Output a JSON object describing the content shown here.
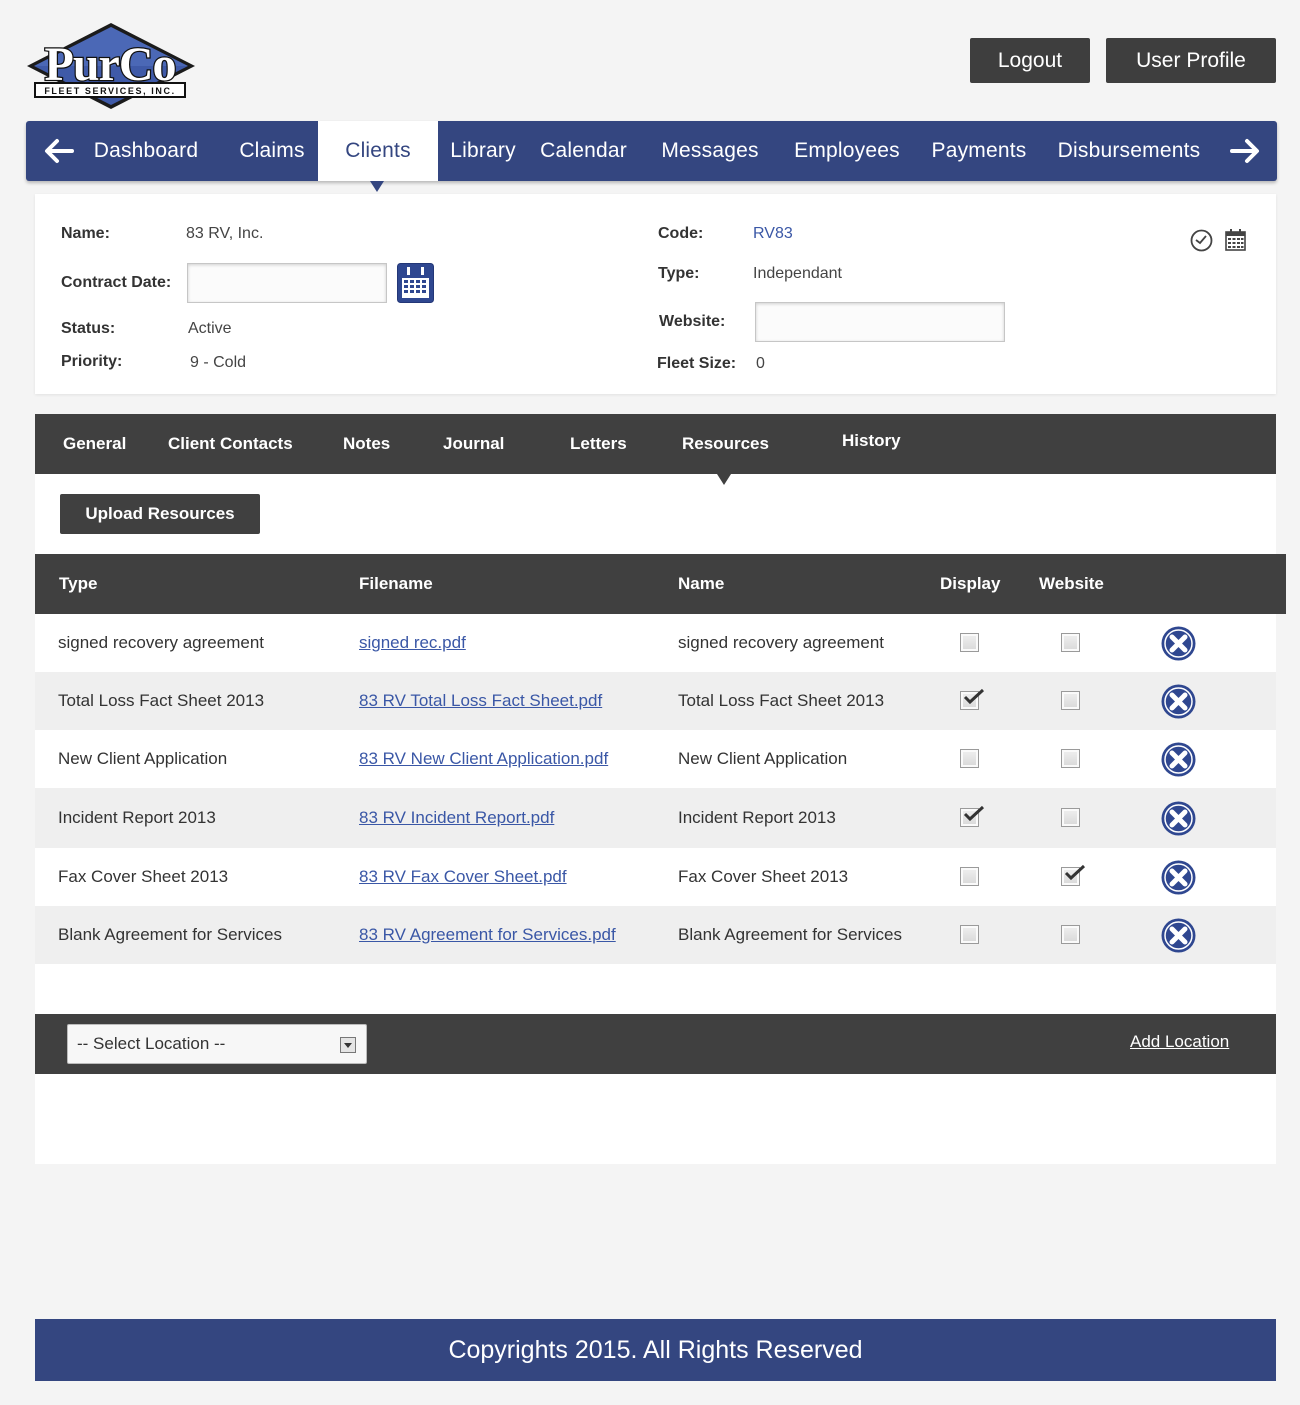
{
  "logo": {
    "name": "PurCo",
    "tagline": "FLEET SERVICES, INC."
  },
  "header": {
    "logout_label": "Logout",
    "profile_label": "User Profile"
  },
  "nav": {
    "items": [
      {
        "label": "Dashboard"
      },
      {
        "label": "Claims"
      },
      {
        "label": "Clients"
      },
      {
        "label": "Library"
      },
      {
        "label": "Calendar"
      },
      {
        "label": "Messages"
      },
      {
        "label": "Employees"
      },
      {
        "label": "Payments"
      },
      {
        "label": "Disbursements"
      }
    ],
    "active": "Clients"
  },
  "client": {
    "name_label": "Name:",
    "name_value": "83 RV, Inc.",
    "contract_label": "Contract Date:",
    "contract_value": "",
    "status_label": "Status:",
    "status_value": "Active",
    "priority_label": "Priority:",
    "priority_value": "9 - Cold",
    "code_label": "Code:",
    "code_value": "RV83",
    "type_label": "Type:",
    "type_value": "Independant",
    "website_label": "Website:",
    "website_value": "",
    "fleet_label": "Fleet Size:",
    "fleet_value": "0"
  },
  "subnav": {
    "items": [
      {
        "label": "General"
      },
      {
        "label": "Client Contacts"
      },
      {
        "label": "Notes"
      },
      {
        "label": "Journal"
      },
      {
        "label": "Letters"
      },
      {
        "label": "Resources"
      },
      {
        "label": "History"
      }
    ],
    "active": "Resources"
  },
  "upload_label": "Upload Resources",
  "table": {
    "headers": [
      "Type",
      "Filename",
      "Name",
      "Display",
      "Website"
    ],
    "rows": [
      {
        "type": "signed recovery agreement",
        "filename": "signed rec.pdf",
        "name": "signed recovery agreement",
        "display": false,
        "website": false
      },
      {
        "type": "Total Loss Fact Sheet 2013",
        "filename": "83 RV Total Loss Fact Sheet.pdf",
        "name": "Total Loss Fact Sheet 2013",
        "display": true,
        "website": false
      },
      {
        "type": "New Client Application",
        "filename": "83 RV New Client Application.pdf",
        "name": "New Client Application",
        "display": false,
        "website": false
      },
      {
        "type": "Incident Report 2013",
        "filename": "83 RV Incident Report.pdf",
        "name": "Incident Report 2013",
        "display": true,
        "website": false
      },
      {
        "type": "Fax Cover Sheet 2013",
        "filename": "83 RV Fax Cover Sheet.pdf",
        "name": "Fax Cover Sheet 2013",
        "display": false,
        "website": true
      },
      {
        "type": "Blank Agreement for Services",
        "filename": "83 RV Agreement for Services.pdf",
        "name": "Blank Agreement for Services",
        "display": false,
        "website": false
      }
    ]
  },
  "location": {
    "select_value": "-- Select Location --",
    "add_label": "Add Location"
  },
  "footer": {
    "text": "Copyrights 2015. All Rights Reserved"
  },
  "colors": {
    "brand": "#344680",
    "dark": "#404040",
    "link": "#3a57a6",
    "row_alt": "#efefef"
  },
  "icons": [
    "arrow-left-icon",
    "arrow-right-icon",
    "calendar-icon",
    "clock-icon",
    "delete-icon",
    "check-icon",
    "dropdown-arrow-icon"
  ]
}
